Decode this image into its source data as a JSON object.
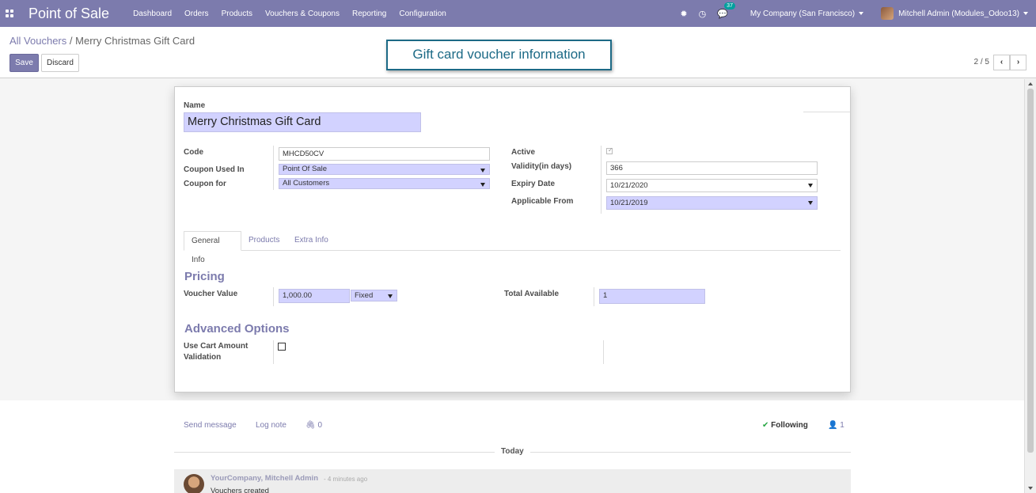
{
  "navbar": {
    "app_title": "Point of Sale",
    "menu": [
      "Dashboard",
      "Orders",
      "Products",
      "Vouchers & Coupons",
      "Reporting",
      "Configuration"
    ],
    "message_count": "37",
    "company": "My Company (San Francisco)",
    "user": "Mitchell Admin (Modules_Odoo13)"
  },
  "control": {
    "breadcrumb_parent": "All Vouchers",
    "breadcrumb_separator": "/",
    "breadcrumb_current": "Merry Christmas Gift Card",
    "save_label": "Save",
    "discard_label": "Discard",
    "callout": "Gift card voucher information",
    "pager": "2 / 5"
  },
  "form": {
    "name_label": "Name",
    "name_value": "Merry Christmas Gift Card",
    "code_label": "Code",
    "code_value": "MHCD50CV",
    "coupon_used_in_label": "Coupon Used In",
    "coupon_used_in_value": "Point Of Sale",
    "coupon_for_label": "Coupon for",
    "coupon_for_value": "All Customers",
    "active_label": "Active",
    "active_checked": true,
    "validity_label": "Validity(in days)",
    "validity_value": "366",
    "expiry_label": "Expiry Date",
    "expiry_value": "10/21/2020",
    "applicable_label": "Applicable From",
    "applicable_value": "10/21/2019"
  },
  "tabs": [
    "General Info",
    "Products",
    "Extra Info"
  ],
  "pricing": {
    "title": "Pricing",
    "voucher_value_label": "Voucher Value",
    "voucher_value": "1,000.00",
    "voucher_type": "Fixed",
    "total_available_label": "Total Available",
    "total_available": "1"
  },
  "advanced": {
    "title": "Advanced Options",
    "cart_label_line1": "Use Cart Amount",
    "cart_label_line2": "Validation",
    "cart_checked": false
  },
  "chatter": {
    "send_message": "Send message",
    "log_note": "Log note",
    "attachments": "0",
    "following": "Following",
    "followers": "1",
    "today": "Today",
    "msg_author": "YourCompany, Mitchell Admin",
    "msg_time": "- 4 minutes ago",
    "msg_body": "Vouchers created"
  },
  "colors": {
    "brand": "#7c7bad",
    "required_field": "#d2d2ff",
    "callout": "#1c6a86",
    "following_check": "#28a745"
  }
}
